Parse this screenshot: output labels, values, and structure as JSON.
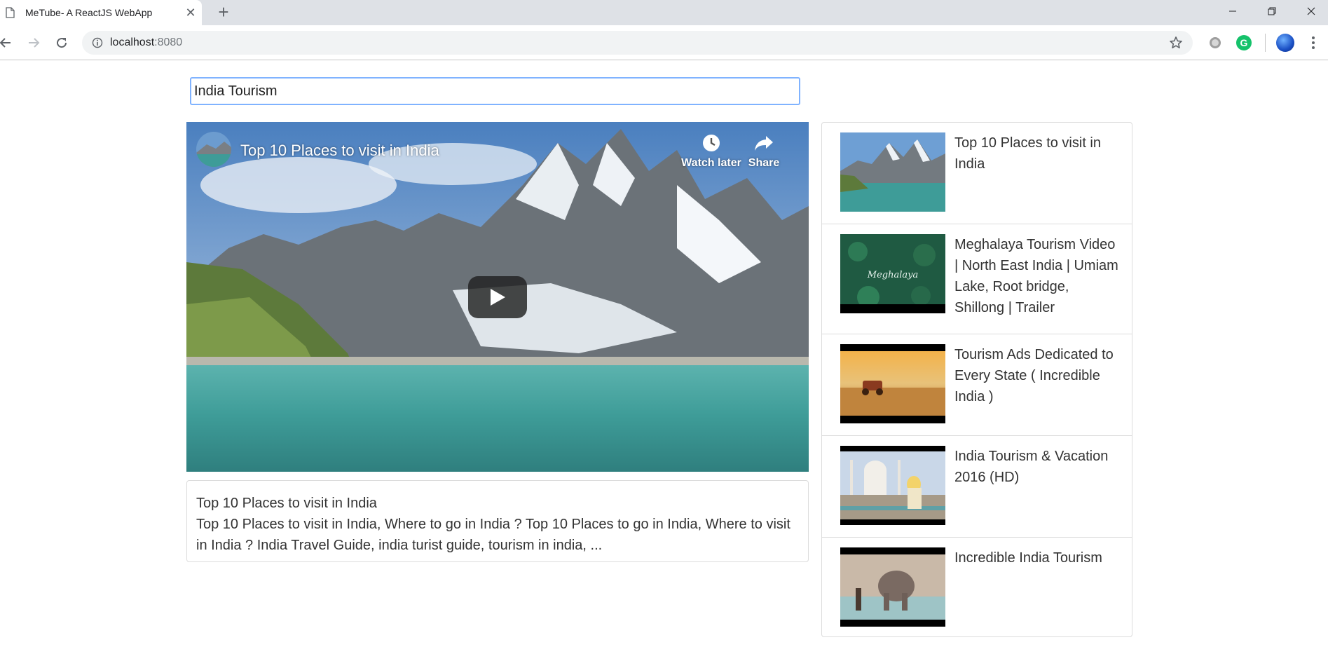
{
  "browser": {
    "tab_title": "MeTube- A ReactJS WebApp",
    "tab_close": "✕",
    "new_tab": "+",
    "url_host": "localhost",
    "url_port": ":8080"
  },
  "search": {
    "value": "India Tourism"
  },
  "player": {
    "title": "Top 10 Places to visit in India",
    "watch_later_label": "Watch later",
    "share_label": "Share"
  },
  "details": {
    "title": "Top 10 Places to visit in India",
    "description": "Top 10 Places to visit in India, Where to go in India ? Top 10 Places to go in India, Where to visit in India ? India Travel Guide, india turist guide, tourism in india, ..."
  },
  "video_list": [
    {
      "title": "Top 10 Places to visit in India"
    },
    {
      "title": "Meghalaya Tourism Video | North East India | Umiam Lake, Root bridge, Shillong | Trailer",
      "thumb_text": "Meghalaya"
    },
    {
      "title": "Tourism Ads Dedicated to Every State ( Incredible India )"
    },
    {
      "title": "India Tourism & Vacation 2016 (HD)"
    },
    {
      "title": "Incredible India Tourism"
    }
  ],
  "colors": {
    "search_focus_border": "#80b3ff",
    "card_border": "#dcdcdc",
    "text": "#333333"
  }
}
